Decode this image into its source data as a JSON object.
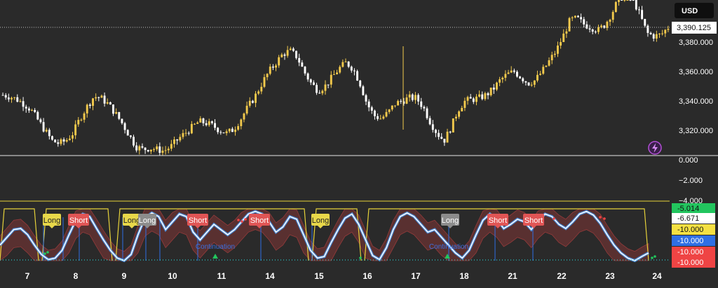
{
  "currency_label": "USD",
  "colors": {
    "background": "#2a2a2a",
    "candle_up": "#f2c94c",
    "candle_down": "#ffffff",
    "osc_line": "#ffffff",
    "osc_glow": "#4aa3ff",
    "signal_yellow": "#e6d23a",
    "band_red": "#b23b3b",
    "long_label_bg": "#e8d84a",
    "long_label_bg_alt": "#8c8c8c",
    "short_label_bg": "#e05555",
    "continuation_text": "#3b6fe0",
    "continuation_marker": "#22c55e",
    "dotted_cyan": "#29c7c7",
    "axis_text": "#ffffff"
  },
  "price_axis": {
    "ticks": [
      "3,380.000",
      "3,360.000",
      "3,340.000",
      "3,320.000"
    ],
    "last_price_label": "3,390.125"
  },
  "middle_axis": {
    "ticks": [
      "0.000",
      "−2.000",
      "−4.000"
    ]
  },
  "oscillator_axis": {
    "labels": [
      {
        "text": "-5.014",
        "bg": "#22c55e"
      },
      {
        "text": "-6.671",
        "bg": "#ffffff"
      },
      {
        "text": "-10.000",
        "bg": "#f5e042"
      },
      {
        "text": "-10.000",
        "bg": "#2f6fe4"
      },
      {
        "text": "-10.000",
        "bg": "#ef4444"
      },
      {
        "text": "-10.000",
        "bg": "#ef4444"
      }
    ]
  },
  "time_axis": {
    "labels": [
      "7",
      "8",
      "9",
      "10",
      "11",
      "14",
      "15",
      "16",
      "17",
      "18",
      "21",
      "22",
      "23",
      "24"
    ]
  },
  "signals": [
    {
      "text": "Long",
      "type": "long"
    },
    {
      "text": "Short",
      "type": "short"
    },
    {
      "text": "Long",
      "type": "long"
    },
    {
      "text": "Long",
      "type": "long_alt"
    },
    {
      "text": "Short",
      "type": "short"
    },
    {
      "text": "Short",
      "type": "short"
    },
    {
      "text": "Long",
      "type": "long"
    },
    {
      "text": "Long",
      "type": "long_alt"
    },
    {
      "text": "Short",
      "type": "short"
    },
    {
      "text": "Short",
      "type": "short"
    }
  ],
  "annotations": [
    {
      "text": "Continuation"
    },
    {
      "text": "Continuation"
    }
  ],
  "chart_data": {
    "type": "candlestick",
    "subtype": "candlestick with oscillator sub-panes",
    "y_axis_range": [
      3305,
      3405
    ],
    "x_labels": [
      "7",
      "8",
      "9",
      "10",
      "11",
      "14",
      "15",
      "16",
      "17",
      "18",
      "21",
      "22",
      "23",
      "24"
    ],
    "price_path": [
      3344,
      3343,
      3341,
      3338,
      3334,
      3327,
      3320,
      3313,
      3311,
      3313,
      3318,
      3328,
      3336,
      3343,
      3342,
      3338,
      3332,
      3325,
      3317,
      3309,
      3307,
      3308,
      3307,
      3306,
      3309,
      3314,
      3318,
      3322,
      3326,
      3325,
      3323,
      3320,
      3318,
      3321,
      3328,
      3336,
      3343,
      3352,
      3360,
      3366,
      3372,
      3374,
      3370,
      3360,
      3352,
      3347,
      3350,
      3356,
      3362,
      3366,
      3362,
      3352,
      3338,
      3330,
      3328,
      3332,
      3338,
      3340,
      3342,
      3342,
      3336,
      3326,
      3318,
      3313,
      3322,
      3334,
      3340,
      3341,
      3342,
      3344,
      3348,
      3354,
      3358,
      3360,
      3356,
      3352,
      3354,
      3360,
      3367,
      3374,
      3384,
      3395,
      3396,
      3392,
      3390,
      3388,
      3392,
      3400,
      3410,
      3412,
      3409,
      3398,
      3386,
      3384,
      3385,
      3390
    ],
    "oscillator_path": [
      0.3,
      0.45,
      0.6,
      0.62,
      0.5,
      0.3,
      0.12,
      0.02,
      0.05,
      0.2,
      0.5,
      0.78,
      0.9,
      0.85,
      0.62,
      0.4,
      0.2,
      0.05,
      0.0,
      0.12,
      0.5,
      0.82,
      0.92,
      0.85,
      0.6,
      0.75,
      0.9,
      0.85,
      0.55,
      0.4,
      0.55,
      0.7,
      0.6,
      0.5,
      0.6,
      0.75,
      0.9,
      0.95,
      0.9,
      0.75,
      0.55,
      0.65,
      0.85,
      0.8,
      0.5,
      0.2,
      0.05,
      0.08,
      0.35,
      0.6,
      0.82,
      0.9,
      0.7,
      0.4,
      0.1,
      0.02,
      0.25,
      0.6,
      0.85,
      0.92,
      0.85,
      0.7,
      0.55,
      0.6,
      0.45,
      0.3,
      0.15,
      0.05,
      0.2,
      0.5,
      0.78,
      0.9,
      0.8,
      0.62,
      0.7,
      0.8,
      0.75,
      0.6,
      0.78,
      0.9,
      0.85,
      0.7,
      0.62,
      0.75,
      0.9,
      0.95,
      0.88,
      0.72,
      0.5,
      0.3,
      0.15,
      0.05,
      0.0,
      0.08,
      0.15
    ]
  }
}
